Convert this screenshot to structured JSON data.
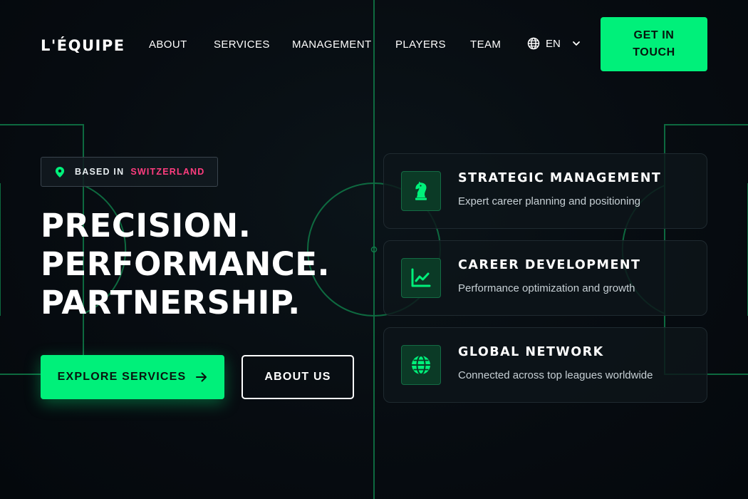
{
  "colors": {
    "accent": "#00f07a",
    "highlight": "#ff3d7f",
    "background": "#060b10",
    "pitch_lines": "#0f7a48"
  },
  "header": {
    "logo": "L'ÉQUIPE",
    "nav": [
      {
        "label": "ABOUT"
      },
      {
        "label": "SERVICES"
      },
      {
        "label": "MANAGEMENT"
      },
      {
        "label": "PLAYERS"
      },
      {
        "label": "TEAM"
      }
    ],
    "language": {
      "icon": "globe-icon",
      "value": "EN",
      "chevron_icon": "chevron-down-icon"
    },
    "cta_label": "GET IN TOUCH"
  },
  "hero": {
    "badge": {
      "icon": "location-pin-icon",
      "prefix": "BASED IN",
      "location": "SWITZERLAND"
    },
    "headline": [
      "PRECISION.",
      "PERFORMANCE.",
      "PARTNERSHIP."
    ],
    "primary_button": {
      "label": "EXPLORE SERVICES",
      "icon": "arrow-right-icon"
    },
    "secondary_button": {
      "label": "ABOUT US"
    }
  },
  "services": [
    {
      "icon": "chess-knight-icon",
      "title": "STRATEGIC MANAGEMENT",
      "description": "Expert career planning and positioning"
    },
    {
      "icon": "line-chart-icon",
      "title": "CAREER DEVELOPMENT",
      "description": "Performance optimization and growth"
    },
    {
      "icon": "globe-icon",
      "title": "GLOBAL NETWORK",
      "description": "Connected across top leagues worldwide"
    }
  ]
}
